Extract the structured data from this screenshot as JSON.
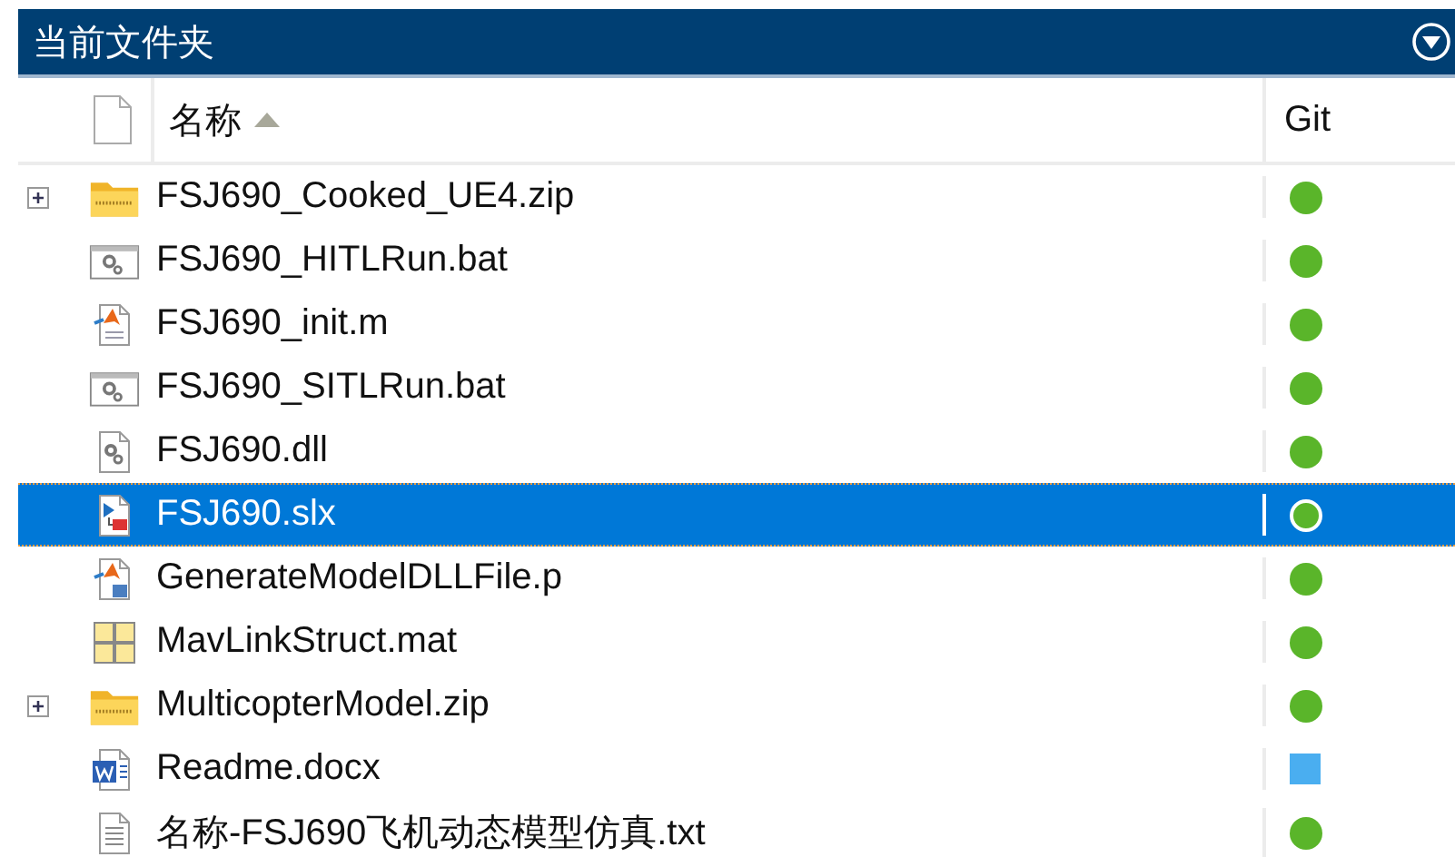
{
  "panel": {
    "title": "当前文件夹"
  },
  "header": {
    "name_column": "名称",
    "sort_ascending": true,
    "git_column": "Git"
  },
  "files": [
    {
      "name": "FSJ690_Cooked_UE4.zip",
      "kind": "zip",
      "expandable": true,
      "selected": false,
      "git": {
        "kind": "dot",
        "color": "#5ab52a"
      }
    },
    {
      "name": "FSJ690_HITLRun.bat",
      "kind": "bat",
      "expandable": false,
      "selected": false,
      "git": {
        "kind": "dot",
        "color": "#5ab52a"
      }
    },
    {
      "name": "FSJ690_init.m",
      "kind": "m",
      "expandable": false,
      "selected": false,
      "git": {
        "kind": "dot",
        "color": "#5ab52a"
      }
    },
    {
      "name": "FSJ690_SITLRun.bat",
      "kind": "bat",
      "expandable": false,
      "selected": false,
      "git": {
        "kind": "dot",
        "color": "#5ab52a"
      }
    },
    {
      "name": "FSJ690.dll",
      "kind": "dll",
      "expandable": false,
      "selected": false,
      "git": {
        "kind": "dot",
        "color": "#5ab52a"
      }
    },
    {
      "name": "FSJ690.slx",
      "kind": "slx",
      "expandable": false,
      "selected": true,
      "git": {
        "kind": "dot",
        "color": "#5ab52a"
      }
    },
    {
      "name": "GenerateModelDLLFile.p",
      "kind": "p",
      "expandable": false,
      "selected": false,
      "git": {
        "kind": "dot",
        "color": "#5ab52a"
      }
    },
    {
      "name": "MavLinkStruct.mat",
      "kind": "mat",
      "expandable": false,
      "selected": false,
      "git": {
        "kind": "dot",
        "color": "#5ab52a"
      }
    },
    {
      "name": "MulticopterModel.zip",
      "kind": "zip",
      "expandable": true,
      "selected": false,
      "git": {
        "kind": "dot",
        "color": "#5ab52a"
      }
    },
    {
      "name": "Readme.docx",
      "kind": "docx",
      "expandable": false,
      "selected": false,
      "git": {
        "kind": "square",
        "color": "#4aaef0"
      }
    },
    {
      "name": "名称-FSJ690飞机动态模型仿真.txt",
      "kind": "txt",
      "expandable": false,
      "selected": false,
      "git": {
        "kind": "dot",
        "color": "#5ab52a"
      }
    }
  ]
}
